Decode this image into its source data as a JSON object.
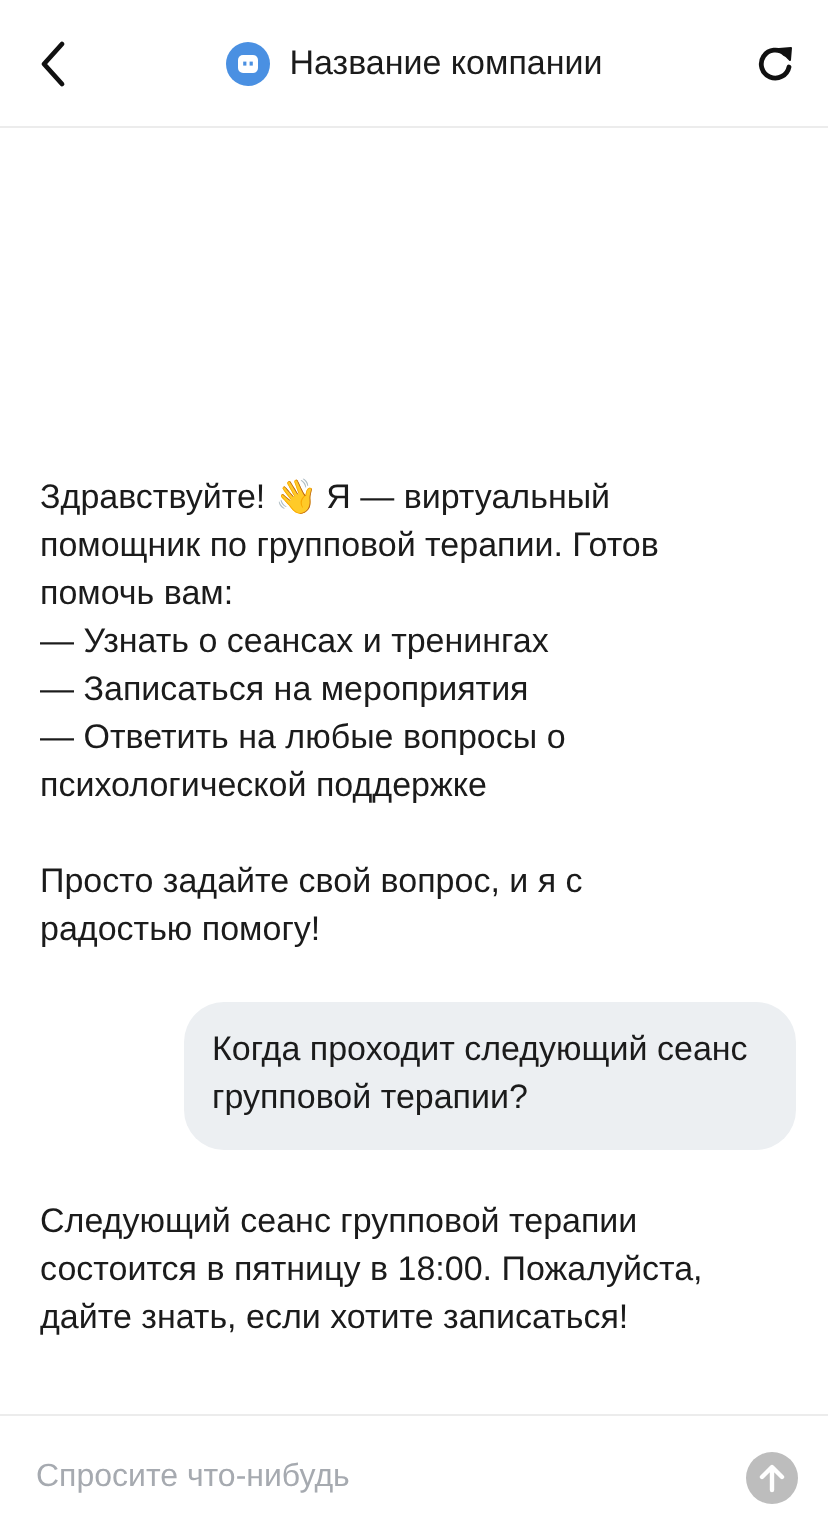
{
  "header": {
    "title": "Название компании"
  },
  "messages": [
    {
      "kind": "bot",
      "blocks": [
        [
          "Здравствуйте! 👋 Я — виртуальный помощник по групповой терапии. Готов помочь вам:",
          "— Узнать о сеансах и тренингах",
          "— Записаться на мероприятия",
          "— Ответить на любые вопросы о психологической поддержке"
        ],
        [
          "Просто задайте свой вопрос, и я с радостью помогу!"
        ]
      ]
    },
    {
      "kind": "user",
      "blocks": [
        [
          "Когда проходит следующий сеанс групповой терапии?"
        ]
      ]
    },
    {
      "kind": "bot",
      "blocks": [
        [
          "Следующий сеанс групповой терапии состоится в пятницу в 18:00. Пожалуйста, дайте знать, если хотите записаться!"
        ]
      ]
    }
  ],
  "composer": {
    "placeholder": "Спросите что-нибудь",
    "disabled": true
  }
}
